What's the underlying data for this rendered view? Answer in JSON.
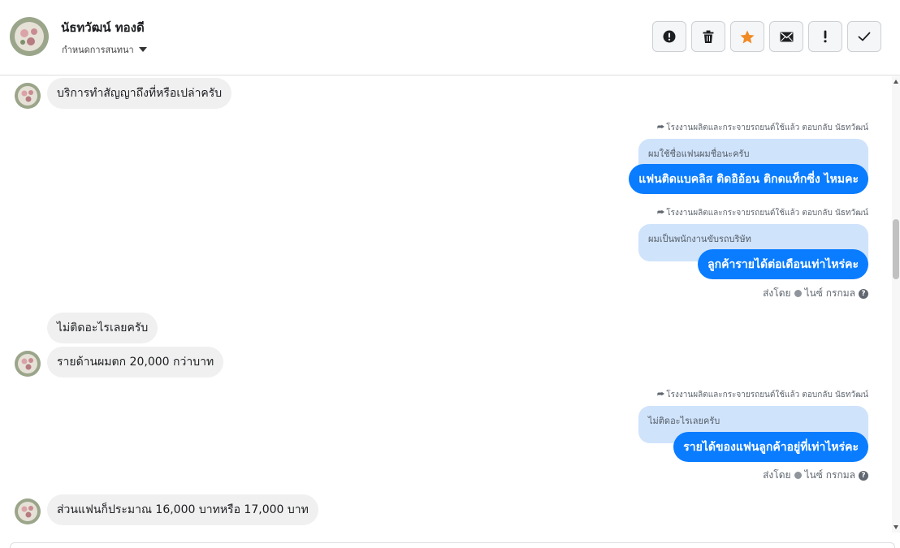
{
  "header": {
    "contact_name": "นัธทวัฒน์ ทองดี",
    "assign_label": "กำหนดการสนทนา",
    "toolbar": [
      {
        "name": "spam-button",
        "icon": "alert-circle-icon"
      },
      {
        "name": "delete-button",
        "icon": "trash-icon"
      },
      {
        "name": "star-button",
        "icon": "star-icon"
      },
      {
        "name": "mark-unread-button",
        "icon": "envelope-icon"
      },
      {
        "name": "follow-up-button",
        "icon": "exclamation-icon"
      },
      {
        "name": "mark-done-button",
        "icon": "check-icon"
      }
    ]
  },
  "colors": {
    "outgoing_bubble": "#0a7cff",
    "reply_quote": "#cfe3fb",
    "incoming_bubble": "#f0f0f0",
    "star": "#f08a24"
  },
  "messages": [
    {
      "type": "incoming",
      "text": "บริการทำสัญญาถึงที่หรือเปล่าครับ"
    },
    {
      "type": "outgoing",
      "reply_meta": "โรงงานผลิตและกระจายรถยนต์ใช้แล้ว ตอบกลับ นัธทวัฒน์",
      "quote": "ผมใช้ชื่อแฟนผมชื่อนะครับ",
      "text": "แฟนติดแบคลิส ติดอิอ้อน ติกดแท็กซี่ง ไหมคะ"
    },
    {
      "type": "outgoing",
      "reply_meta": "โรงงานผลิตและกระจายรถยนต์ใช้แล้ว ตอบกลับ นัธทวัฒน์",
      "quote": "ผมเป็นพนักงานขับรถบริษัท",
      "text": "ลูกค้ารายได้ต่อเดือนเท่าไหร่คะ",
      "sent_by": "ส่งโดย",
      "sender": "ไนซ์ กรกมล"
    },
    {
      "type": "incoming",
      "text": "ไม่ติดอะไรเลยครับ"
    },
    {
      "type": "incoming",
      "text": "รายด้านผมตก 20,000 กว่าบาท"
    },
    {
      "type": "outgoing",
      "reply_meta": "โรงงานผลิตและกระจายรถยนต์ใช้แล้ว ตอบกลับ นัธทวัฒน์",
      "quote": "ไม่ติดอะไรเลยครับ",
      "text": "รายได้ของแฟนลูกค้าอยู่ที่เท่าไหร่คะ",
      "sent_by": "ส่งโดย",
      "sender": "ไนซ์ กรกมล"
    },
    {
      "type": "incoming",
      "text": "ส่วนแฟนก็ประมาณ 16,000 บาทหรือ 17,000 บาท"
    }
  ]
}
